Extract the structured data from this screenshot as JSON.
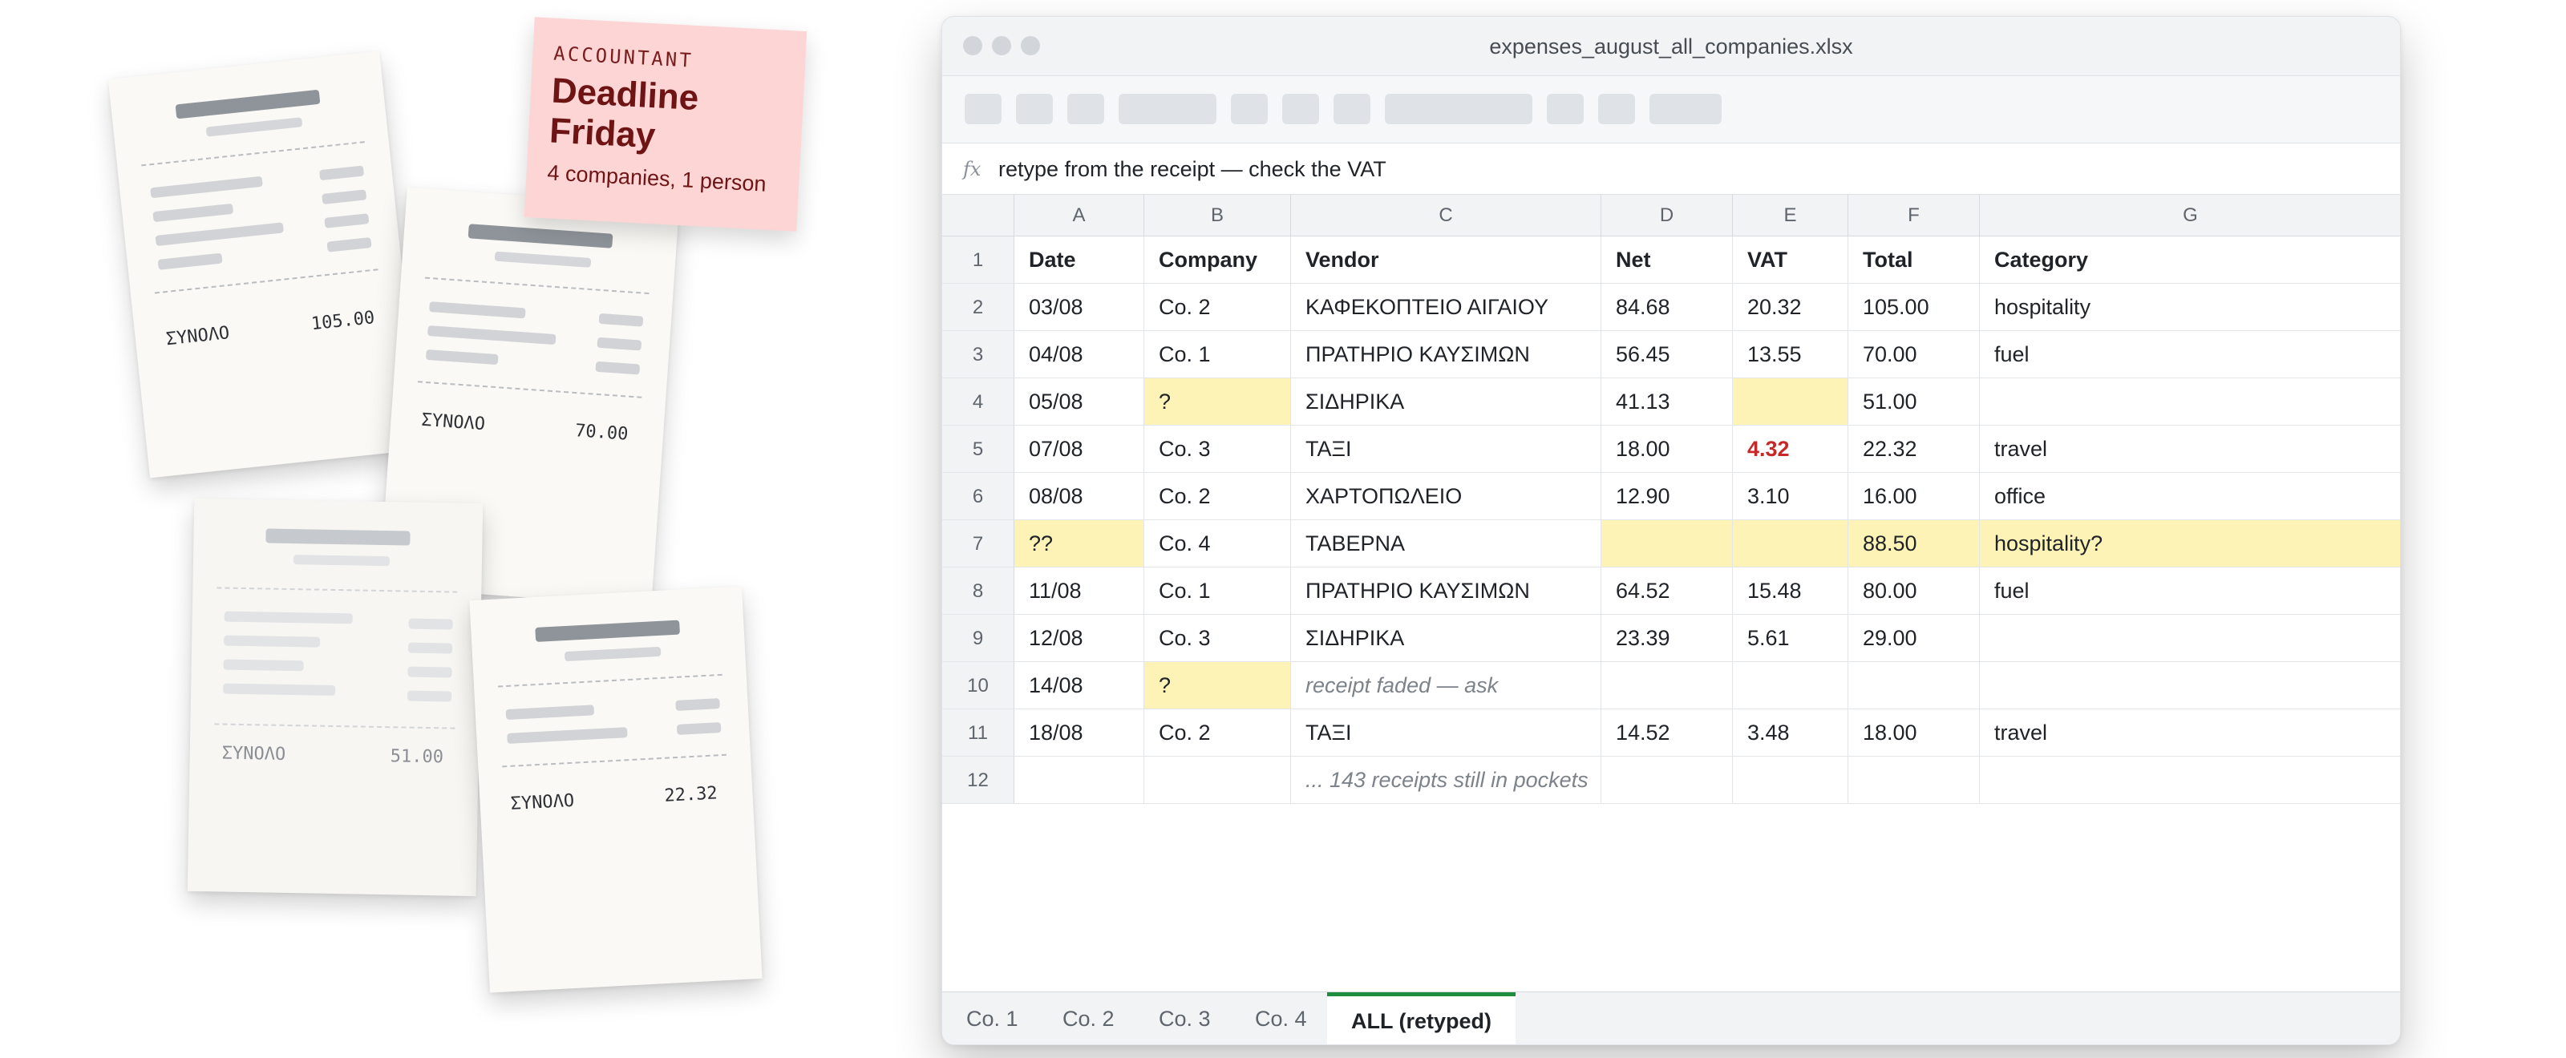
{
  "sticky_note": {
    "tag": "ACCOUNTANT",
    "title_line1": "Deadline",
    "title_line2": "Friday",
    "subtitle": "4 companies, 1 person"
  },
  "receipts": [
    {
      "label": "ΣΥΝΟΛΟ",
      "total": "105.00"
    },
    {
      "label": "ΣΥΝΟΛΟ",
      "total": "70.00"
    },
    {
      "label": "ΣΥΝΟΛΟ",
      "total": "51.00"
    },
    {
      "label": "ΣΥΝΟΛΟ",
      "total": "22.32"
    }
  ],
  "window": {
    "title": "expenses_august_all_companies.xlsx",
    "formula_label": "fx",
    "formula": "retype from the receipt — check the VAT"
  },
  "sheet": {
    "columns": [
      "A",
      "B",
      "C",
      "D",
      "E",
      "F",
      "G"
    ],
    "rows": [
      {
        "num": "1",
        "cells": [
          "Date",
          "Company",
          "Vendor",
          "Net",
          "VAT",
          "Total",
          "Category"
        ]
      },
      {
        "num": "2",
        "cells": [
          "03/08",
          "Co. 2",
          "ΚΑΦΕΚΟΠΤΕΙΟ ΑΙΓΑΙΟΥ",
          "84.68",
          "20.32",
          "105.00",
          "hospitality"
        ]
      },
      {
        "num": "3",
        "cells": [
          "04/08",
          "Co. 1",
          "ΠΡΑΤΗΡΙΟ ΚΑΥΣΙΜΩΝ",
          "56.45",
          "13.55",
          "70.00",
          "fuel"
        ]
      },
      {
        "num": "4",
        "cells": [
          "05/08",
          "?",
          "ΣΙΔΗΡΙΚΑ",
          "41.13",
          "",
          "51.00",
          ""
        ]
      },
      {
        "num": "5",
        "cells": [
          "07/08",
          "Co. 3",
          "ΤΑΞΙ",
          "18.00",
          "4.32",
          "22.32",
          "travel"
        ]
      },
      {
        "num": "6",
        "cells": [
          "08/08",
          "Co. 2",
          "ΧΑΡΤΟΠΩΛΕΙΟ",
          "12.90",
          "3.10",
          "16.00",
          "office"
        ]
      },
      {
        "num": "7",
        "cells": [
          "??",
          "Co. 4",
          "ΤΑΒΕΡΝΑ",
          "",
          "",
          "88.50",
          "hospitality?"
        ]
      },
      {
        "num": "8",
        "cells": [
          "11/08",
          "Co. 1",
          "ΠΡΑΤΗΡΙΟ ΚΑΥΣΙΜΩΝ",
          "64.52",
          "15.48",
          "80.00",
          "fuel"
        ]
      },
      {
        "num": "9",
        "cells": [
          "12/08",
          "Co. 3",
          "ΣΙΔΗΡΙΚΑ",
          "23.39",
          "5.61",
          "29.00",
          ""
        ]
      },
      {
        "num": "10",
        "cells": [
          "14/08",
          "?",
          "receipt faded — ask",
          "",
          "",
          "",
          ""
        ]
      },
      {
        "num": "11",
        "cells": [
          "18/08",
          "Co. 2",
          "ΤΑΞΙ",
          "14.52",
          "3.48",
          "18.00",
          "travel"
        ]
      },
      {
        "num": "12",
        "cells": [
          "",
          "",
          "... 143 receipts still in pockets",
          "",
          "",
          "",
          ""
        ]
      }
    ],
    "highlight_color": "#fdf3b7",
    "error_color": "#c62828"
  },
  "tabs": [
    {
      "label": "Co. 1",
      "active": false
    },
    {
      "label": "Co. 2",
      "active": false
    },
    {
      "label": "Co. 3",
      "active": false
    },
    {
      "label": "Co. 4",
      "active": false
    },
    {
      "label": "ALL (retyped)",
      "active": true
    }
  ],
  "accent_color": "#1e8e3e"
}
